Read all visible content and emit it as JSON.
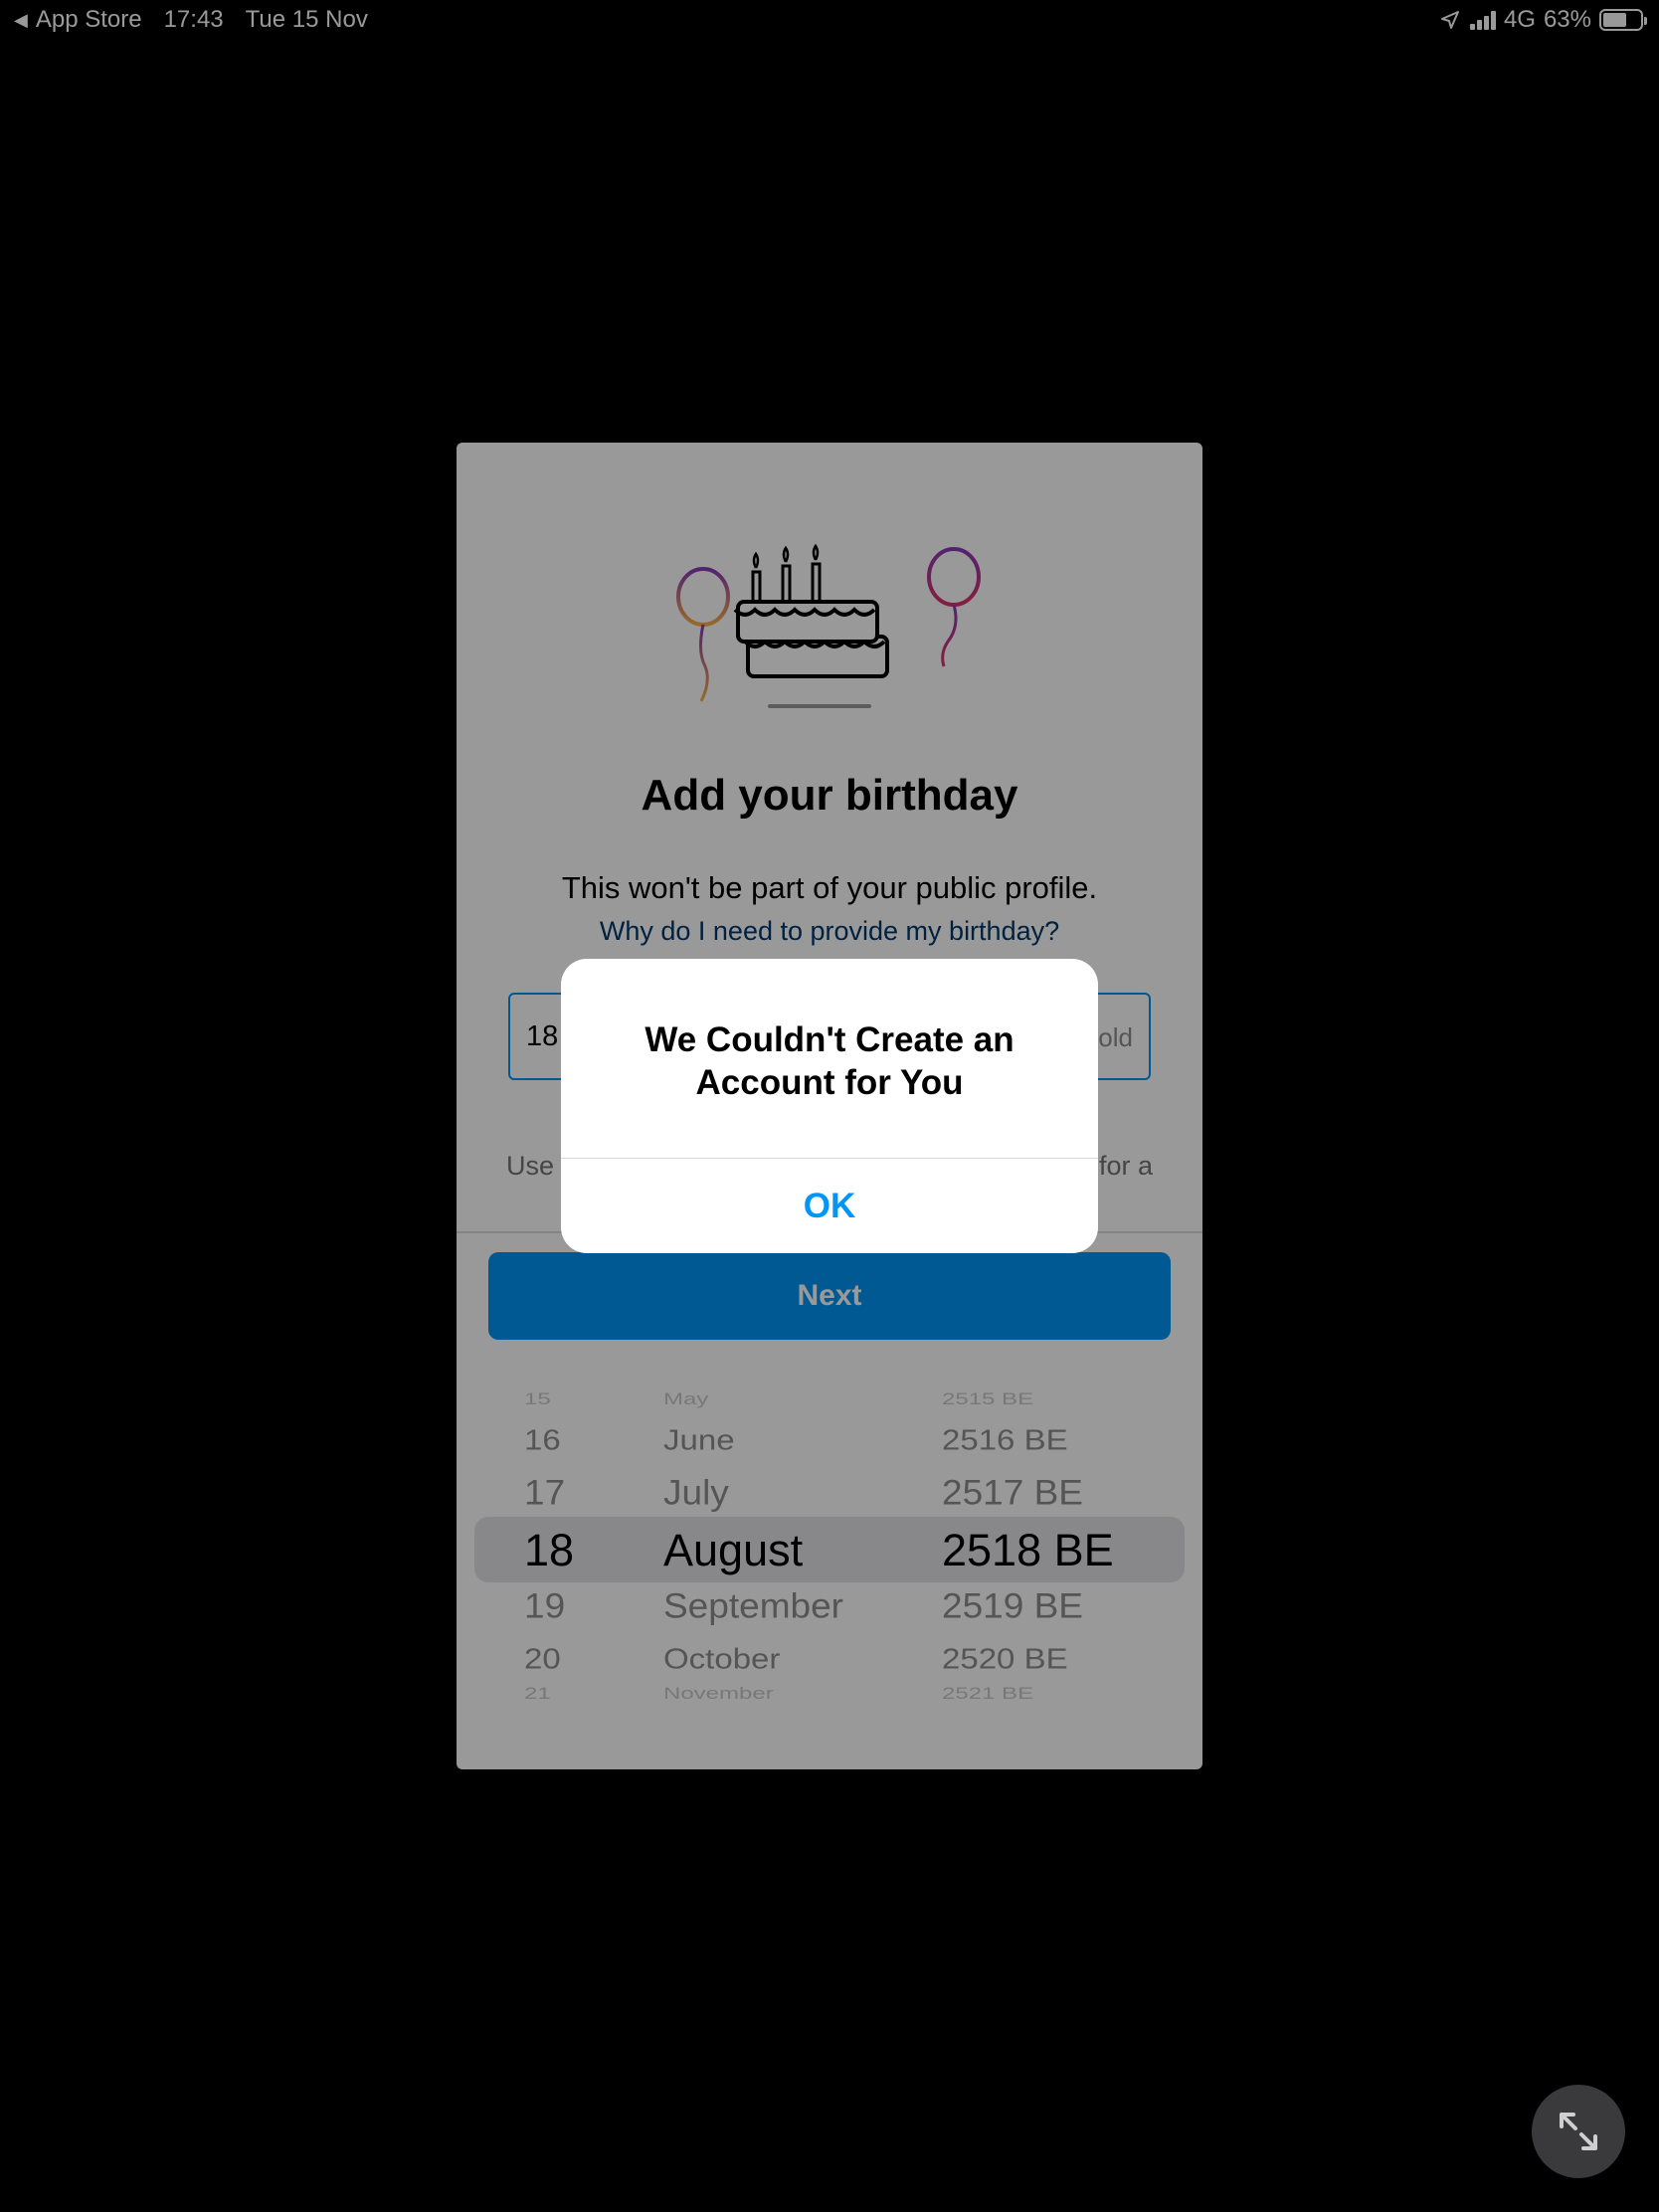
{
  "status_bar": {
    "back_label": "App Store",
    "time": "17:43",
    "date": "Tue 15 Nov",
    "network": "4G",
    "battery_percent": "63%",
    "battery_level": 0.63,
    "icons": [
      "back-triangle-icon",
      "location-arrow-icon",
      "cellular-signal-icon",
      "battery-icon"
    ]
  },
  "birthday_sheet": {
    "illustration": "birthday-cake-balloons-icon",
    "title": "Add your birthday",
    "subtitle": "This won't be part of your public profile.",
    "why_link": "Why do I need to provide my birthday?",
    "date_field_day": "18",
    "date_field_age_fragment": "old",
    "helper_left_fragment": "Use",
    "helper_right_fragment": "for a",
    "next_button": "Next"
  },
  "date_picker": {
    "selected": {
      "day": "18",
      "month": "August",
      "year": "2518 BE"
    },
    "rows": [
      {
        "day": "15",
        "month": "May",
        "year": "2515 BE"
      },
      {
        "day": "16",
        "month": "June",
        "year": "2516 BE"
      },
      {
        "day": "17",
        "month": "July",
        "year": "2517 BE"
      },
      {
        "day": "18",
        "month": "August",
        "year": "2518 BE"
      },
      {
        "day": "19",
        "month": "September",
        "year": "2519 BE"
      },
      {
        "day": "20",
        "month": "October",
        "year": "2520 BE"
      },
      {
        "day": "21",
        "month": "November",
        "year": "2521 BE"
      }
    ]
  },
  "alert": {
    "title": "We Couldn't Create an Account for You",
    "ok_button": "OK"
  },
  "expand_button": {
    "icon": "expand-arrows-icon"
  },
  "colors": {
    "accent_blue": "#0095f6",
    "link_blue": "#00376b",
    "background": "#000000",
    "sheet": "#ffffff"
  }
}
